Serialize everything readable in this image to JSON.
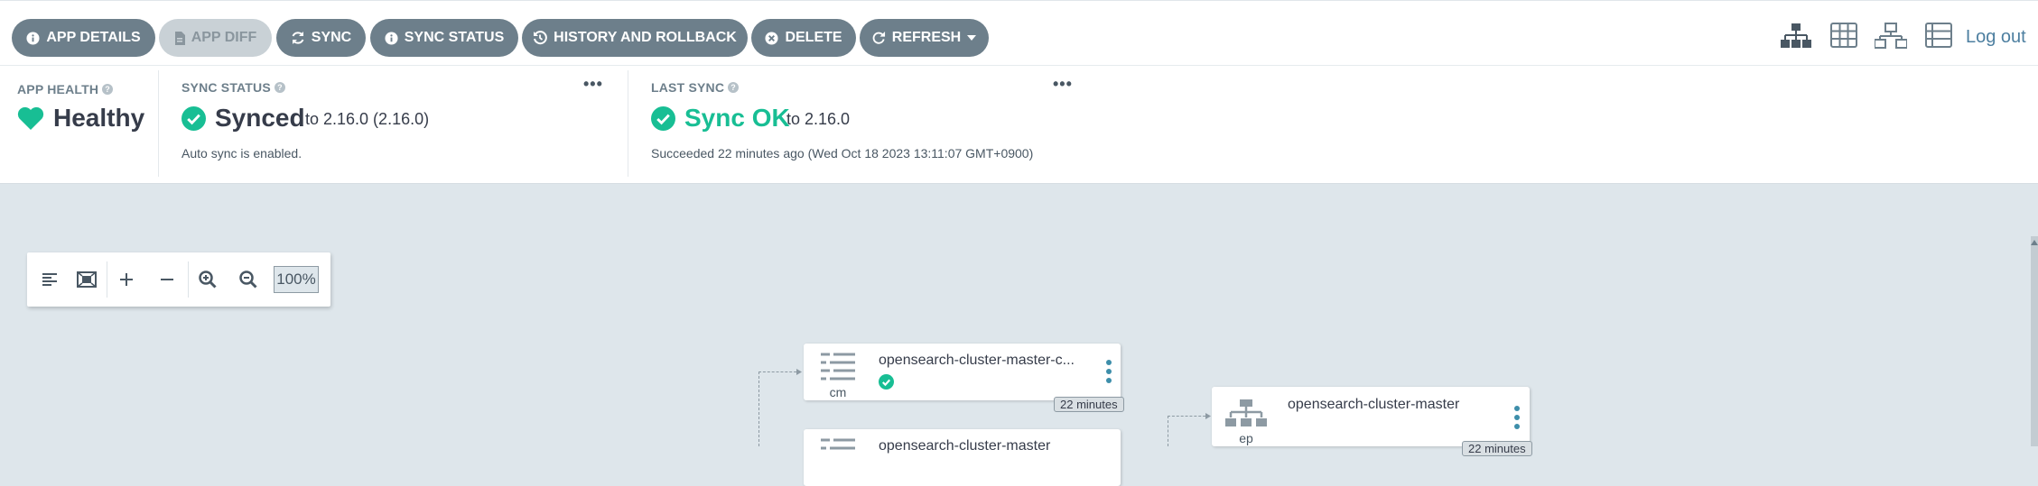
{
  "toolbar": {
    "buttons": [
      {
        "label": "APP DETAILS",
        "icon": "info-icon"
      },
      {
        "label": "APP DIFF",
        "icon": "file-diff-icon",
        "disabled": true
      },
      {
        "label": "SYNC",
        "icon": "sync-icon"
      },
      {
        "label": "SYNC STATUS",
        "icon": "info-icon"
      },
      {
        "label": "HISTORY AND ROLLBACK",
        "icon": "history-icon"
      },
      {
        "label": "DELETE",
        "icon": "delete-icon"
      },
      {
        "label": "REFRESH",
        "icon": "refresh-icon",
        "dropdown": true
      }
    ],
    "view_icons": [
      "tree-view-icon",
      "pods-view-icon",
      "network-view-icon",
      "list-view-icon"
    ],
    "logout_label": "Log out"
  },
  "status": {
    "health": {
      "title": "APP HEALTH",
      "value": "Healthy",
      "color": "#18be94"
    },
    "sync": {
      "title": "SYNC STATUS",
      "value": "Synced",
      "revision": "to 2.16.0 (2.16.0)",
      "note": "Auto sync is enabled.",
      "color": "#18be94"
    },
    "last_sync": {
      "title": "LAST SYNC",
      "value": "Sync OK",
      "revision": "to 2.16.0",
      "note": "Succeeded 22 minutes ago (Wed Oct 18 2023 13:11:07 GMT+0900)",
      "color": "#18be94"
    }
  },
  "graph_toolbar": {
    "tools": [
      "align-left-icon",
      "fit-to-screen-icon",
      "plus-icon",
      "minus-icon",
      "zoom-in-icon",
      "zoom-out-icon"
    ],
    "zoom": "100%"
  },
  "nodes": [
    {
      "kind": "cm",
      "name": "opensearch-cluster-master-c...",
      "age": "22 minutes",
      "icon": "configmap-icon",
      "status_icon": "check-icon"
    },
    {
      "kind": "ep",
      "name": "opensearch-cluster-master",
      "age": "22 minutes",
      "icon": "endpoints-icon"
    },
    {
      "kind": "",
      "name": "opensearch-cluster-master",
      "icon": "configmap-icon"
    }
  ]
}
